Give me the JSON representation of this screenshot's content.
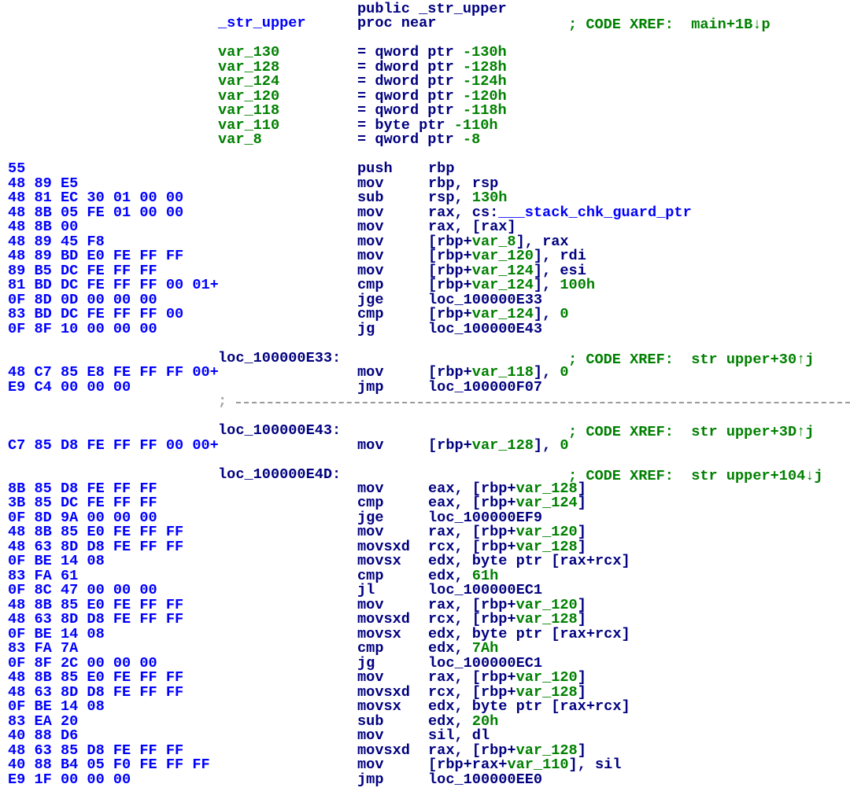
{
  "colors": {
    "bytes": "#0000ff",
    "instruction": "#000080",
    "comment": "#008000",
    "separator": "#a0a0a0"
  },
  "rows": [
    {
      "mnem": "public _str_upper"
    },
    {
      "label": "_str_upper",
      "label_kind": "b",
      "mnem": "proc near",
      "comment": "; CODE XREF:  main+1B↓p"
    },
    {},
    {
      "label": "var_130",
      "label_kind": "g",
      "mnem": "= qword ptr -130h"
    },
    {
      "label": "var_128",
      "label_kind": "g",
      "mnem": "= dword ptr -128h"
    },
    {
      "label": "var_124",
      "label_kind": "g",
      "mnem": "= dword ptr -124h"
    },
    {
      "label": "var_120",
      "label_kind": "g",
      "mnem": "= qword ptr -120h"
    },
    {
      "label": "var_118",
      "label_kind": "g",
      "mnem": "= qword ptr -118h"
    },
    {
      "label": "var_110",
      "label_kind": "g",
      "mnem": "= byte ptr -110h"
    },
    {
      "label": "var_8",
      "label_kind": "g",
      "mnem": "= qword ptr -8"
    },
    {},
    {
      "bytes": "55",
      "mnem": "push",
      "ops": [
        {
          "k": "n",
          "t": "rbp"
        }
      ]
    },
    {
      "bytes": "48 89 E5",
      "mnem": "mov",
      "ops": [
        {
          "k": "n",
          "t": "rbp, rsp"
        }
      ]
    },
    {
      "bytes": "48 81 EC 30 01 00 00",
      "mnem": "sub",
      "ops": [
        {
          "k": "n",
          "t": "rsp, "
        },
        {
          "k": "g",
          "t": "130h"
        }
      ]
    },
    {
      "bytes": "48 8B 05 FE 01 00 00",
      "mnem": "mov",
      "ops": [
        {
          "k": "n",
          "t": "rax, cs:"
        },
        {
          "k": "b",
          "t": "___stack_chk_guard_ptr"
        }
      ]
    },
    {
      "bytes": "48 8B 00",
      "mnem": "mov",
      "ops": [
        {
          "k": "n",
          "t": "rax, [rax]"
        }
      ]
    },
    {
      "bytes": "48 89 45 F8",
      "mnem": "mov",
      "ops": [
        {
          "k": "n",
          "t": "[rbp+"
        },
        {
          "k": "g",
          "t": "var_8"
        },
        {
          "k": "n",
          "t": "], rax"
        }
      ]
    },
    {
      "bytes": "48 89 BD E0 FE FF FF",
      "mnem": "mov",
      "ops": [
        {
          "k": "n",
          "t": "[rbp+"
        },
        {
          "k": "g",
          "t": "var_120"
        },
        {
          "k": "n",
          "t": "], rdi"
        }
      ]
    },
    {
      "bytes": "89 B5 DC FE FF FF",
      "mnem": "mov",
      "ops": [
        {
          "k": "n",
          "t": "[rbp+"
        },
        {
          "k": "g",
          "t": "var_124"
        },
        {
          "k": "n",
          "t": "], esi"
        }
      ]
    },
    {
      "bytes": "81 BD DC FE FF FF 00 01+",
      "mnem": "cmp",
      "ops": [
        {
          "k": "n",
          "t": "[rbp+"
        },
        {
          "k": "g",
          "t": "var_124"
        },
        {
          "k": "n",
          "t": "], "
        },
        {
          "k": "g",
          "t": "100h"
        }
      ]
    },
    {
      "bytes": "0F 8D 0D 00 00 00",
      "mnem": "jge",
      "ops": [
        {
          "k": "n",
          "t": "loc_100000E33"
        }
      ]
    },
    {
      "bytes": "83 BD DC FE FF FF 00",
      "mnem": "cmp",
      "ops": [
        {
          "k": "n",
          "t": "[rbp+"
        },
        {
          "k": "g",
          "t": "var_124"
        },
        {
          "k": "n",
          "t": "], "
        },
        {
          "k": "g",
          "t": "0"
        }
      ]
    },
    {
      "bytes": "0F 8F 10 00 00 00",
      "mnem": "jg",
      "ops": [
        {
          "k": "n",
          "t": "loc_100000E43"
        }
      ]
    },
    {},
    {
      "label": "loc_100000E33:",
      "label_kind": "n",
      "comment": "; CODE XREF:  str upper+30↑j"
    },
    {
      "bytes": "48 C7 85 E8 FE FF FF 00+",
      "mnem": "mov",
      "ops": [
        {
          "k": "n",
          "t": "[rbp+"
        },
        {
          "k": "g",
          "t": "var_118"
        },
        {
          "k": "n",
          "t": "], "
        },
        {
          "k": "g",
          "t": "0"
        }
      ]
    },
    {
      "bytes": "E9 C4 00 00 00",
      "mnem": "jmp",
      "ops": [
        {
          "k": "n",
          "t": "loc_100000F07"
        }
      ]
    },
    {
      "separator": ";"
    },
    {},
    {
      "label": "loc_100000E43:",
      "label_kind": "n",
      "comment": "; CODE XREF:  str upper+3D↑j"
    },
    {
      "bytes": "C7 85 D8 FE FF FF 00 00+",
      "mnem": "mov",
      "ops": [
        {
          "k": "n",
          "t": "[rbp+"
        },
        {
          "k": "g",
          "t": "var_128"
        },
        {
          "k": "n",
          "t": "], "
        },
        {
          "k": "g",
          "t": "0"
        }
      ]
    },
    {},
    {
      "label": "loc_100000E4D:",
      "label_kind": "n",
      "comment": "; CODE XREF:  str upper+104↓j"
    },
    {
      "bytes": "8B 85 D8 FE FF FF",
      "mnem": "mov",
      "ops": [
        {
          "k": "n",
          "t": "eax, [rbp+"
        },
        {
          "k": "g",
          "t": "var_128"
        },
        {
          "k": "n",
          "t": "]"
        }
      ]
    },
    {
      "bytes": "3B 85 DC FE FF FF",
      "mnem": "cmp",
      "ops": [
        {
          "k": "n",
          "t": "eax, [rbp+"
        },
        {
          "k": "g",
          "t": "var_124"
        },
        {
          "k": "n",
          "t": "]"
        }
      ]
    },
    {
      "bytes": "0F 8D 9A 00 00 00",
      "mnem": "jge",
      "ops": [
        {
          "k": "n",
          "t": "loc_100000EF9"
        }
      ]
    },
    {
      "bytes": "48 8B 85 E0 FE FF FF",
      "mnem": "mov",
      "ops": [
        {
          "k": "n",
          "t": "rax, [rbp+"
        },
        {
          "k": "g",
          "t": "var_120"
        },
        {
          "k": "n",
          "t": "]"
        }
      ]
    },
    {
      "bytes": "48 63 8D D8 FE FF FF",
      "mnem": "movsxd",
      "ops": [
        {
          "k": "n",
          "t": "rcx, [rbp+"
        },
        {
          "k": "g",
          "t": "var_128"
        },
        {
          "k": "n",
          "t": "]"
        }
      ]
    },
    {
      "bytes": "0F BE 14 08",
      "mnem": "movsx",
      "ops": [
        {
          "k": "n",
          "t": "edx, byte ptr [rax+rcx]"
        }
      ]
    },
    {
      "bytes": "83 FA 61",
      "mnem": "cmp",
      "ops": [
        {
          "k": "n",
          "t": "edx, "
        },
        {
          "k": "g",
          "t": "61h"
        }
      ]
    },
    {
      "bytes": "0F 8C 47 00 00 00",
      "mnem": "jl",
      "ops": [
        {
          "k": "n",
          "t": "loc_100000EC1"
        }
      ]
    },
    {
      "bytes": "48 8B 85 E0 FE FF FF",
      "mnem": "mov",
      "ops": [
        {
          "k": "n",
          "t": "rax, [rbp+"
        },
        {
          "k": "g",
          "t": "var_120"
        },
        {
          "k": "n",
          "t": "]"
        }
      ]
    },
    {
      "bytes": "48 63 8D D8 FE FF FF",
      "mnem": "movsxd",
      "ops": [
        {
          "k": "n",
          "t": "rcx, [rbp+"
        },
        {
          "k": "g",
          "t": "var_128"
        },
        {
          "k": "n",
          "t": "]"
        }
      ]
    },
    {
      "bytes": "0F BE 14 08",
      "mnem": "movsx",
      "ops": [
        {
          "k": "n",
          "t": "edx, byte ptr [rax+rcx]"
        }
      ]
    },
    {
      "bytes": "83 FA 7A",
      "mnem": "cmp",
      "ops": [
        {
          "k": "n",
          "t": "edx, "
        },
        {
          "k": "g",
          "t": "7Ah"
        }
      ]
    },
    {
      "bytes": "0F 8F 2C 00 00 00",
      "mnem": "jg",
      "ops": [
        {
          "k": "n",
          "t": "loc_100000EC1"
        }
      ]
    },
    {
      "bytes": "48 8B 85 E0 FE FF FF",
      "mnem": "mov",
      "ops": [
        {
          "k": "n",
          "t": "rax, [rbp+"
        },
        {
          "k": "g",
          "t": "var_120"
        },
        {
          "k": "n",
          "t": "]"
        }
      ]
    },
    {
      "bytes": "48 63 8D D8 FE FF FF",
      "mnem": "movsxd",
      "ops": [
        {
          "k": "n",
          "t": "rcx, [rbp+"
        },
        {
          "k": "g",
          "t": "var_128"
        },
        {
          "k": "n",
          "t": "]"
        }
      ]
    },
    {
      "bytes": "0F BE 14 08",
      "mnem": "movsx",
      "ops": [
        {
          "k": "n",
          "t": "edx, byte ptr [rax+rcx]"
        }
      ]
    },
    {
      "bytes": "83 EA 20",
      "mnem": "sub",
      "ops": [
        {
          "k": "n",
          "t": "edx, "
        },
        {
          "k": "g",
          "t": "20h"
        }
      ]
    },
    {
      "bytes": "40 88 D6",
      "mnem": "mov",
      "ops": [
        {
          "k": "n",
          "t": "sil, dl"
        }
      ]
    },
    {
      "bytes": "48 63 85 D8 FE FF FF",
      "mnem": "movsxd",
      "ops": [
        {
          "k": "n",
          "t": "rax, [rbp+"
        },
        {
          "k": "g",
          "t": "var_128"
        },
        {
          "k": "n",
          "t": "]"
        }
      ]
    },
    {
      "bytes": "40 88 B4 05 F0 FE FF FF",
      "mnem": "mov",
      "ops": [
        {
          "k": "n",
          "t": "[rbp+rax+"
        },
        {
          "k": "g",
          "t": "var_110"
        },
        {
          "k": "n",
          "t": "], sil"
        }
      ]
    },
    {
      "bytes": "E9 1F 00 00 00",
      "mnem": "jmp",
      "ops": [
        {
          "k": "n",
          "t": "loc_100000EE0"
        }
      ]
    }
  ]
}
